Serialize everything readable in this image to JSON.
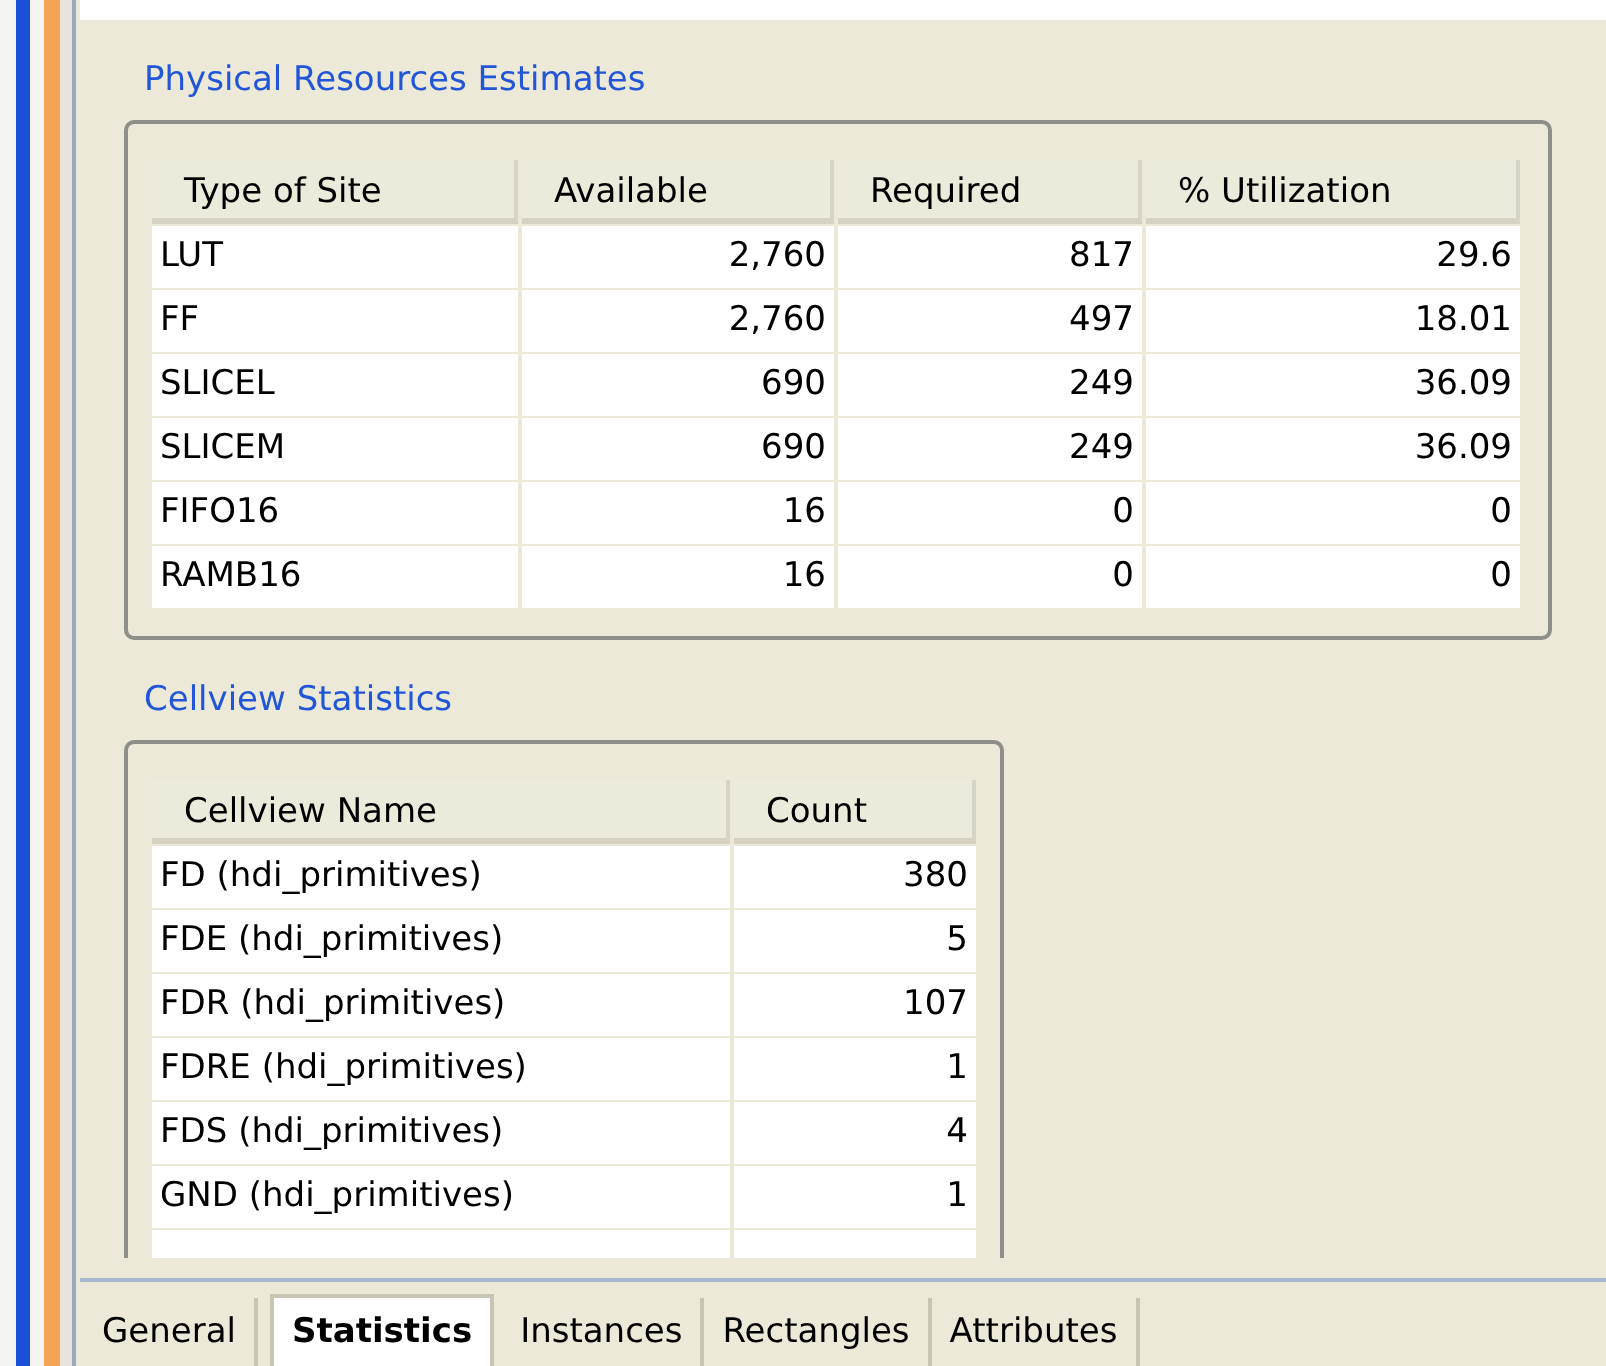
{
  "resources": {
    "title": "Physical Resources Estimates",
    "columns": [
      "Type of Site",
      "Available",
      "Required",
      "% Utilization"
    ],
    "rows": [
      [
        "LUT",
        "2,760",
        "817",
        "29.6"
      ],
      [
        "FF",
        "2,760",
        "497",
        "18.01"
      ],
      [
        "SLICEL",
        "690",
        "249",
        "36.09"
      ],
      [
        "SLICEM",
        "690",
        "249",
        "36.09"
      ],
      [
        "FIFO16",
        "16",
        "0",
        "0"
      ],
      [
        "RAMB16",
        "16",
        "0",
        "0"
      ]
    ]
  },
  "cellview": {
    "title": "Cellview Statistics",
    "columns": [
      "Cellview Name",
      "Count"
    ],
    "rows": [
      [
        "FD (hdi_primitives)",
        "380"
      ],
      [
        "FDE (hdi_primitives)",
        "5"
      ],
      [
        "FDR (hdi_primitives)",
        "107"
      ],
      [
        "FDRE (hdi_primitives)",
        "1"
      ],
      [
        "FDS (hdi_primitives)",
        "4"
      ],
      [
        "GND (hdi_primitives)",
        "1"
      ]
    ]
  },
  "tabs": [
    {
      "label": "General",
      "selected": false
    },
    {
      "label": "Statistics",
      "selected": true
    },
    {
      "label": "Instances",
      "selected": false
    },
    {
      "label": "Rectangles",
      "selected": false
    },
    {
      "label": "Attributes",
      "selected": false
    }
  ]
}
